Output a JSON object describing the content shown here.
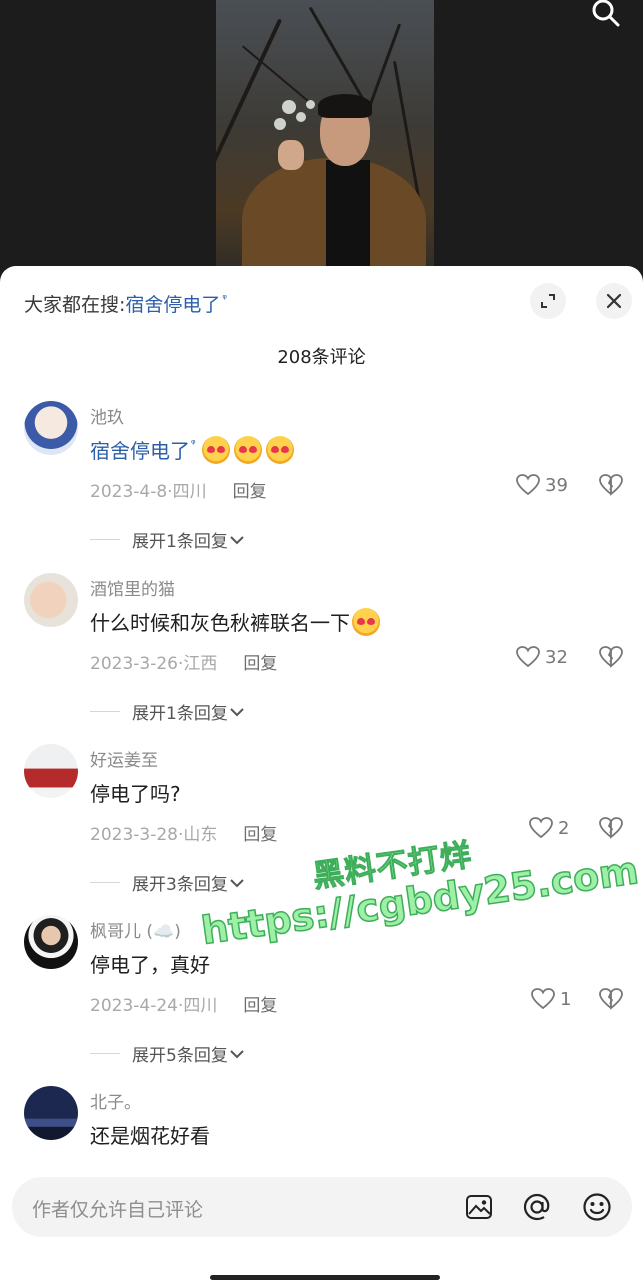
{
  "header": {
    "prefix": "大家都在搜:",
    "search_link": "宿舍停电了",
    "search_mark": "ᵠ"
  },
  "comment_count": "208条评论",
  "comments": [
    {
      "user": "池玖",
      "text": "宿舍停电了",
      "is_link": true,
      "emoji_count": 3,
      "date": "2023-4-8·四川",
      "reply": "回复",
      "likes": "39",
      "expand": "展开1条回复"
    },
    {
      "user": "酒馆里的猫",
      "text": "什么时候和灰色秋裤联名一下",
      "emoji_count": 1,
      "date": "2023-3-26·江西",
      "reply": "回复",
      "likes": "32",
      "expand": "展开1条回复"
    },
    {
      "user": "好运姜至",
      "text": "停电了吗?",
      "date": "2023-3-28·山东",
      "reply": "回复",
      "likes": "2",
      "expand": "展开3条回复"
    },
    {
      "user": "枫哥儿 (☁️)",
      "text": "停电了，真好",
      "date": "2023-4-24·四川",
      "reply": "回复",
      "likes": "1",
      "expand": "展开5条回复"
    },
    {
      "user": "北子。",
      "text": "还是烟花好看"
    }
  ],
  "watermark": {
    "line1": "黑料不打烊",
    "line2": "https://cgbdy25.com"
  },
  "input": {
    "placeholder": "作者仅允许自己评论"
  },
  "icons": [
    "search-icon",
    "expand-icon",
    "close-icon",
    "heart-icon",
    "dislike-icon",
    "chevron-down-icon",
    "image-icon",
    "at-icon",
    "emoji-icon"
  ]
}
